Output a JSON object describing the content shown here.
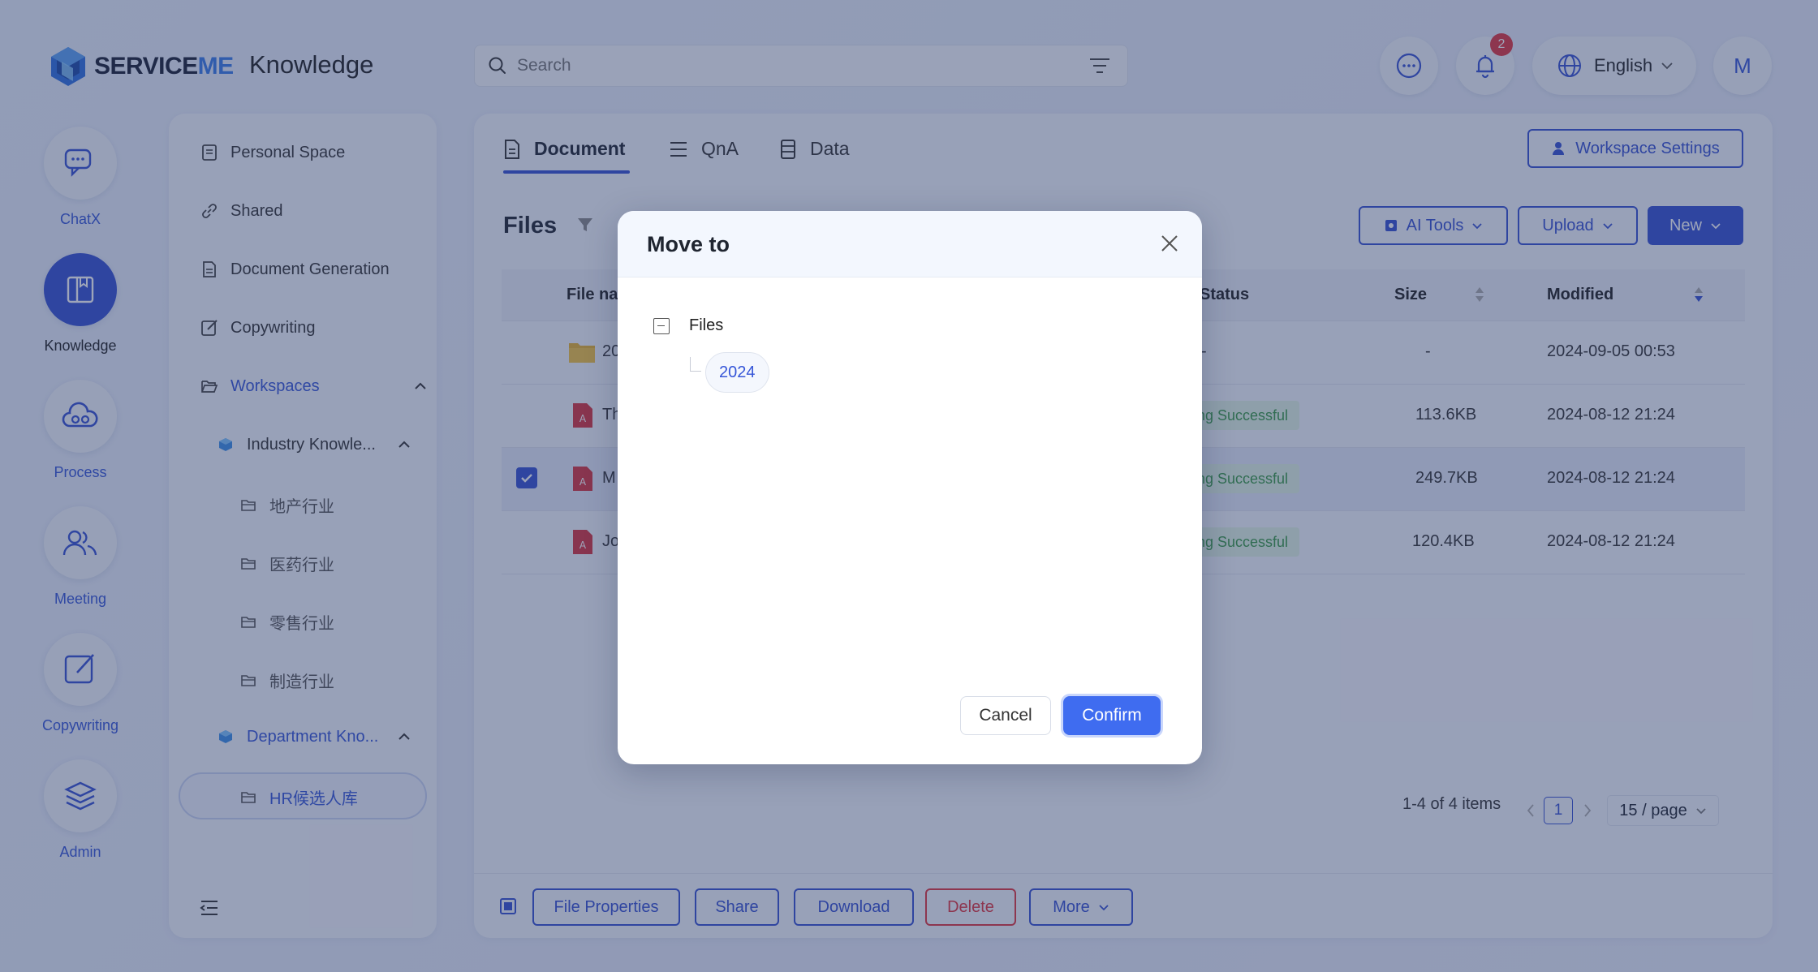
{
  "header": {
    "logo_prefix": "SERVICE",
    "logo_suffix": "ME",
    "app_title": "Knowledge",
    "search_placeholder": "Search",
    "notification_count": "2",
    "language": "English",
    "avatar_initial": "M"
  },
  "left_nav": [
    {
      "label": "ChatX",
      "icon": "chat-icon"
    },
    {
      "label": "Knowledge",
      "icon": "book-icon",
      "active": true
    },
    {
      "label": "Process",
      "icon": "cloud-flow-icon"
    },
    {
      "label": "Meeting",
      "icon": "users-icon"
    },
    {
      "label": "Copywriting",
      "icon": "edit-icon"
    },
    {
      "label": "Admin",
      "icon": "layers-icon"
    }
  ],
  "sidebar": {
    "items": [
      {
        "label": "Personal Space"
      },
      {
        "label": "Shared"
      },
      {
        "label": "Document Generation"
      },
      {
        "label": "Copywriting"
      },
      {
        "label": "Workspaces"
      },
      {
        "label": "Industry Knowle..."
      },
      {
        "label": "地产行业"
      },
      {
        "label": "医药行业"
      },
      {
        "label": "零售行业"
      },
      {
        "label": "制造行业"
      },
      {
        "label": "Department Kno..."
      },
      {
        "label": "HR候选人库"
      }
    ]
  },
  "main": {
    "tabs": [
      {
        "label": "Document"
      },
      {
        "label": "QnA"
      },
      {
        "label": "Data"
      }
    ],
    "workspace_settings": "Workspace Settings",
    "files_title": "Files",
    "toolbar": {
      "ai_tools": "AI Tools",
      "upload": "Upload",
      "new": "New"
    },
    "columns": {
      "file_name": "File na",
      "status": "Status",
      "size": "Size",
      "modified": "Modified"
    },
    "rows": [
      {
        "name": "20",
        "type": "folder",
        "status": "-",
        "size": "-",
        "modified": "2024-09-05 00:53"
      },
      {
        "name": "Th",
        "type": "pdf",
        "status": "xing Successful",
        "size": "113.6KB",
        "modified": "2024-08-12 21:24"
      },
      {
        "name": "M",
        "type": "pdf",
        "status": "xing Successful",
        "size": "249.7KB",
        "modified": "2024-08-12 21:24",
        "selected": true
      },
      {
        "name": "Jo",
        "type": "pdf",
        "status": "xing Successful",
        "size": "120.4KB",
        "modified": "2024-08-12 21:24"
      }
    ],
    "pagination": {
      "summary": "1-4 of 4 items",
      "current_page": "1",
      "page_size": "15 / page"
    },
    "bottom_actions": {
      "file_properties": "File Properties",
      "share": "Share",
      "download": "Download",
      "delete": "Delete",
      "more": "More"
    }
  },
  "modal": {
    "title": "Move to",
    "tree_root": "Files",
    "tree_child": "2024",
    "cancel": "Cancel",
    "confirm": "Confirm"
  },
  "colors": {
    "accent": "#3550d2",
    "confirm": "#3f6cf0",
    "danger": "#e0353f",
    "success_bg": "#e2f5e4",
    "success_text": "#3a9a46"
  }
}
